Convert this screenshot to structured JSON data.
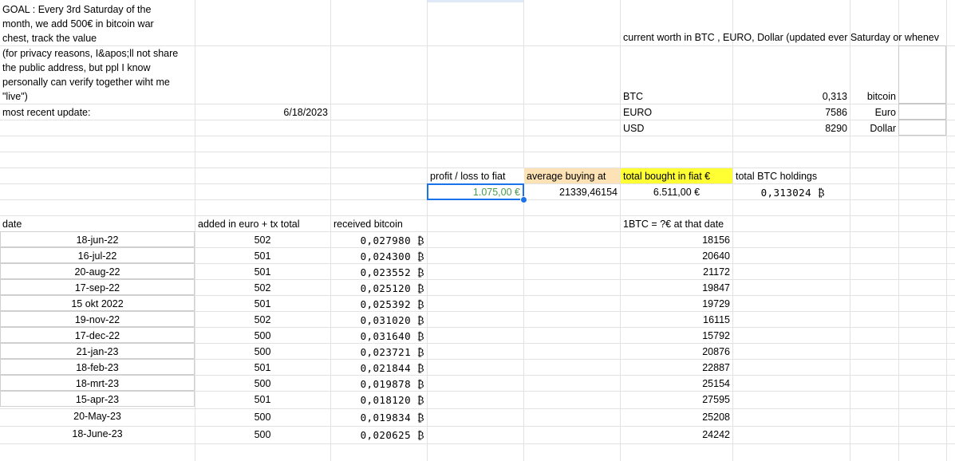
{
  "header": {
    "goal": "GOAL : Every 3rd Saturday of the month, we add 500€ in bitcoin war chest, track the value",
    "privacy": "(for privacy reasons, I&apos;ll not share the public address, but ppl I know personally can verify together wiht me \"live\")",
    "recent_label": "most recent update:",
    "recent_date": "6/18/2023",
    "worth_title": "current worth in BTC , EURO, Dollar (updated ever Saturday or whenev"
  },
  "worth": [
    {
      "label": "BTC",
      "value": "0,313",
      "unit": "bitcoin"
    },
    {
      "label": "EURO",
      "value": "7586",
      "unit": "Euro"
    },
    {
      "label": "USD",
      "value": "8290",
      "unit": "Dollar"
    }
  ],
  "summary": {
    "profit_label": "profit / loss to fiat",
    "profit_value": "1.075,00 €",
    "avg_label": "average buying at",
    "avg_value": "21339,46154",
    "total_label": "total bought in fiat €",
    "total_value": "6.511,00 €",
    "holdings_label": "total BTC holdings",
    "holdings_value": "0,313024 ₿"
  },
  "table": {
    "headers": {
      "date": "date",
      "added": "added in euro + tx total",
      "received": "received bitcoin",
      "rate": "1BTC = ?€ at that date"
    },
    "rows": [
      {
        "date": "18-jun-22",
        "added": "502",
        "btc": "0,027980 ₿",
        "rate": "18156"
      },
      {
        "date": "16-jul-22",
        "added": "501",
        "btc": "0,024300 ₿",
        "rate": "20640"
      },
      {
        "date": "20-aug-22",
        "added": "501",
        "btc": "0,023552 ₿",
        "rate": "21172"
      },
      {
        "date": "17-sep-22",
        "added": "502",
        "btc": "0,025120 ₿",
        "rate": "19847"
      },
      {
        "date": "15 okt 2022",
        "added": "501",
        "btc": "0,025392 ₿",
        "rate": "19729"
      },
      {
        "date": "19-nov-22",
        "added": "502",
        "btc": "0,031020 ₿",
        "rate": "16115"
      },
      {
        "date": "17-dec-22",
        "added": "500",
        "btc": "0,031640 ₿",
        "rate": "15792"
      },
      {
        "date": "21-jan-23",
        "added": "500",
        "btc": "0,023721 ₿",
        "rate": "20876"
      },
      {
        "date": "18-feb-23",
        "added": "501",
        "btc": "0,021844 ₿",
        "rate": "22887"
      },
      {
        "date": "18-mrt-23",
        "added": "500",
        "btc": "0,019878 ₿",
        "rate": "25154"
      },
      {
        "date": "15-apr-23",
        "added": "501",
        "btc": "0,018120 ₿",
        "rate": "27595"
      },
      {
        "date": "20-May-23",
        "added": "500",
        "btc": "0,019834 ₿",
        "rate": "25208"
      },
      {
        "date": "18-June-23",
        "added": "500",
        "btc": "0,020625 ₿",
        "rate": "24242"
      }
    ]
  },
  "colors": {
    "orange_fill": "#fce2b4",
    "yellow_fill": "#ffff33",
    "selection": "#1a73e8",
    "profit_text": "#4a9a4a"
  }
}
